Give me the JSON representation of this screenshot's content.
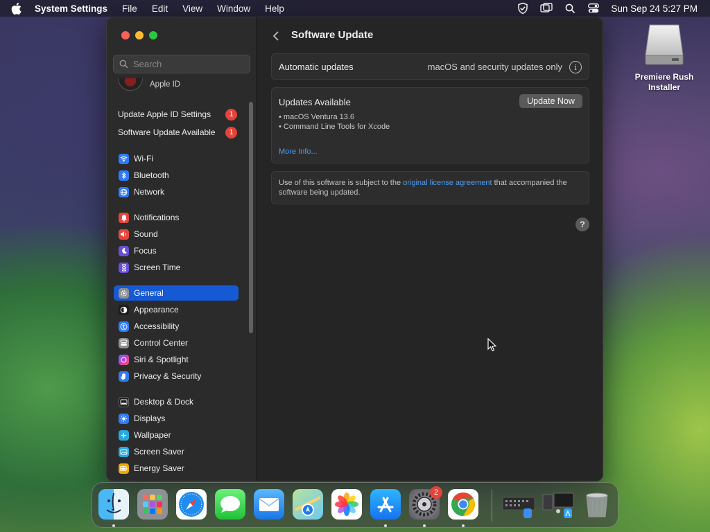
{
  "menubar": {
    "app_name": "System Settings",
    "menus": [
      "File",
      "Edit",
      "View",
      "Window",
      "Help"
    ],
    "clock": "Sun Sep 24  5:27 PM"
  },
  "sidebar": {
    "search_placeholder": "Search",
    "apple_id_label": "Apple ID",
    "notices": [
      {
        "label": "Update Apple ID Settings",
        "badge": "1"
      },
      {
        "label": "Software Update Available",
        "badge": "1"
      }
    ],
    "groups": [
      [
        {
          "label": "Wi-Fi",
          "icon": "wifi-icon",
          "color": "#2f7bf6"
        },
        {
          "label": "Bluetooth",
          "icon": "bluetooth-icon",
          "color": "#2f7bf6"
        },
        {
          "label": "Network",
          "icon": "globe-icon",
          "color": "#2f7bf6"
        }
      ],
      [
        {
          "label": "Notifications",
          "icon": "bell-icon",
          "color": "#e8453c"
        },
        {
          "label": "Sound",
          "icon": "speaker-icon",
          "color": "#e8453c"
        },
        {
          "label": "Focus",
          "icon": "moon-icon",
          "color": "#6a4fd8"
        },
        {
          "label": "Screen Time",
          "icon": "hourglass-icon",
          "color": "#6a4fd8"
        }
      ],
      [
        {
          "label": "General",
          "icon": "gear-icon",
          "color": "#8e8e93",
          "selected": true
        },
        {
          "label": "Appearance",
          "icon": "appearance-icon",
          "color": "#1c1c1e"
        },
        {
          "label": "Accessibility",
          "icon": "accessibility-icon",
          "color": "#2f7bf6"
        },
        {
          "label": "Control Center",
          "icon": "control-center-icon",
          "color": "#8e8e93"
        },
        {
          "label": "Siri & Spotlight",
          "icon": "siri-icon",
          "color": "#c43fd1"
        },
        {
          "label": "Privacy & Security",
          "icon": "hand-icon",
          "color": "#2f7bf6"
        }
      ],
      [
        {
          "label": "Desktop & Dock",
          "icon": "dock-icon",
          "color": "#1c1c1e"
        },
        {
          "label": "Displays",
          "icon": "sun-icon",
          "color": "#2f7bf6"
        },
        {
          "label": "Wallpaper",
          "icon": "wallpaper-icon",
          "color": "#29a8e0"
        },
        {
          "label": "Screen Saver",
          "icon": "screensaver-icon",
          "color": "#29a8e0"
        },
        {
          "label": "Energy Saver",
          "icon": "battery-icon",
          "color": "#f2a900"
        }
      ]
    ]
  },
  "content": {
    "title": "Software Update",
    "automatic_updates_label": "Automatic updates",
    "automatic_updates_value": "macOS and security updates only",
    "info_glyph": "i",
    "updates_heading": "Updates Available",
    "update_now_label": "Update Now",
    "updates": [
      "• macOS Ventura 13.6",
      "• Command Line Tools for Xcode"
    ],
    "more_info_label": "More Info...",
    "license_prefix": "Use of this software is subject to the ",
    "license_link": "original license agreement",
    "license_suffix": " that accompanied the software being updated.",
    "help_glyph": "?"
  },
  "desktop": {
    "icon_label_line1": "Premiere Rush",
    "icon_label_line2": "Installer"
  },
  "dock": {
    "apps": [
      {
        "name": "finder",
        "running": true
      },
      {
        "name": "launchpad",
        "running": false
      },
      {
        "name": "safari",
        "running": false
      },
      {
        "name": "messages",
        "running": false
      },
      {
        "name": "mail",
        "running": false
      },
      {
        "name": "maps",
        "running": false
      },
      {
        "name": "photos",
        "running": false
      },
      {
        "name": "app-store",
        "running": true
      },
      {
        "name": "system-settings",
        "running": true,
        "badge": "2"
      },
      {
        "name": "chrome",
        "running": true
      }
    ]
  }
}
